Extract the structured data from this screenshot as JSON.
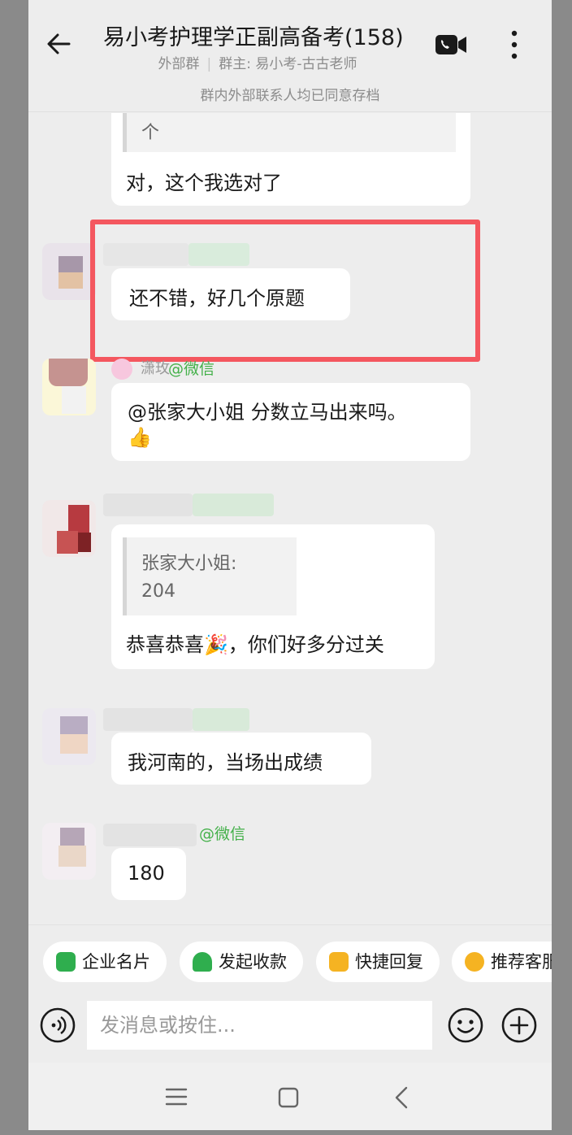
{
  "header": {
    "title": "易小考护理学正副高备考(158)",
    "subtitle_type": "外部群",
    "subtitle_separator": "|",
    "subtitle_owner": "群主: 易小考-古古老师"
  },
  "notice": "群内外部联系人均已同意存档",
  "messages": [
    {
      "quote_tail": "个",
      "text": "对，这个我选对了"
    },
    {
      "text": "还不错，好几个原题"
    },
    {
      "sender_tag": "@微信",
      "sender_partial": "潇玫",
      "text_line1": "@张家大小姐 分数立马出来吗。",
      "text_line2": "👍"
    },
    {
      "quote_name": "张家大小姐:",
      "quote_value": "204",
      "text": "恭喜恭喜🎉，你们好多分过关"
    },
    {
      "text": "我河南的，当场出成绩"
    },
    {
      "sender_tag": "@微信",
      "text": "180"
    }
  ],
  "quick_actions": [
    {
      "label": "企业名片",
      "color": "#2fae4e"
    },
    {
      "label": "发起收款",
      "color": "#2fae4e"
    },
    {
      "label": "快捷回复",
      "color": "#f5b322"
    },
    {
      "label": "推荐客服",
      "color": "#f5b322"
    }
  ],
  "input": {
    "placeholder": "发消息或按住..."
  },
  "colors": {
    "background": "#ededed",
    "bubble": "#ffffff",
    "highlight": "#f4575f",
    "wechat_tag": "#43b049"
  }
}
